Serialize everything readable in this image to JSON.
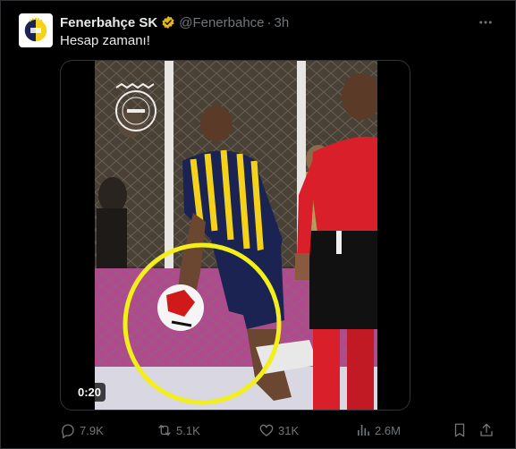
{
  "post": {
    "author_name": "Fenerbahçe SK",
    "handle": "@Fenerbahce",
    "separator": "·",
    "time": "3h",
    "text": "Hesap zamanı!",
    "video_duration": "0:20",
    "verified_color": "#e2b719"
  },
  "stats": {
    "replies": "7.9K",
    "reposts": "5.1K",
    "likes": "31K",
    "views": "2.6M"
  },
  "icons": {
    "more": "more-icon",
    "reply": "reply-icon",
    "repost": "repost-icon",
    "like": "like-icon",
    "views": "views-icon",
    "bookmark": "bookmark-icon",
    "share": "share-icon"
  },
  "colors": {
    "background": "#000000",
    "text": "#e7e9ea",
    "muted": "#71767b",
    "highlight_circle": "#f2ef1a",
    "referee_shirt": "#d9202a",
    "kit_navy": "#1b2353",
    "kit_yellow": "#f4d21a"
  }
}
